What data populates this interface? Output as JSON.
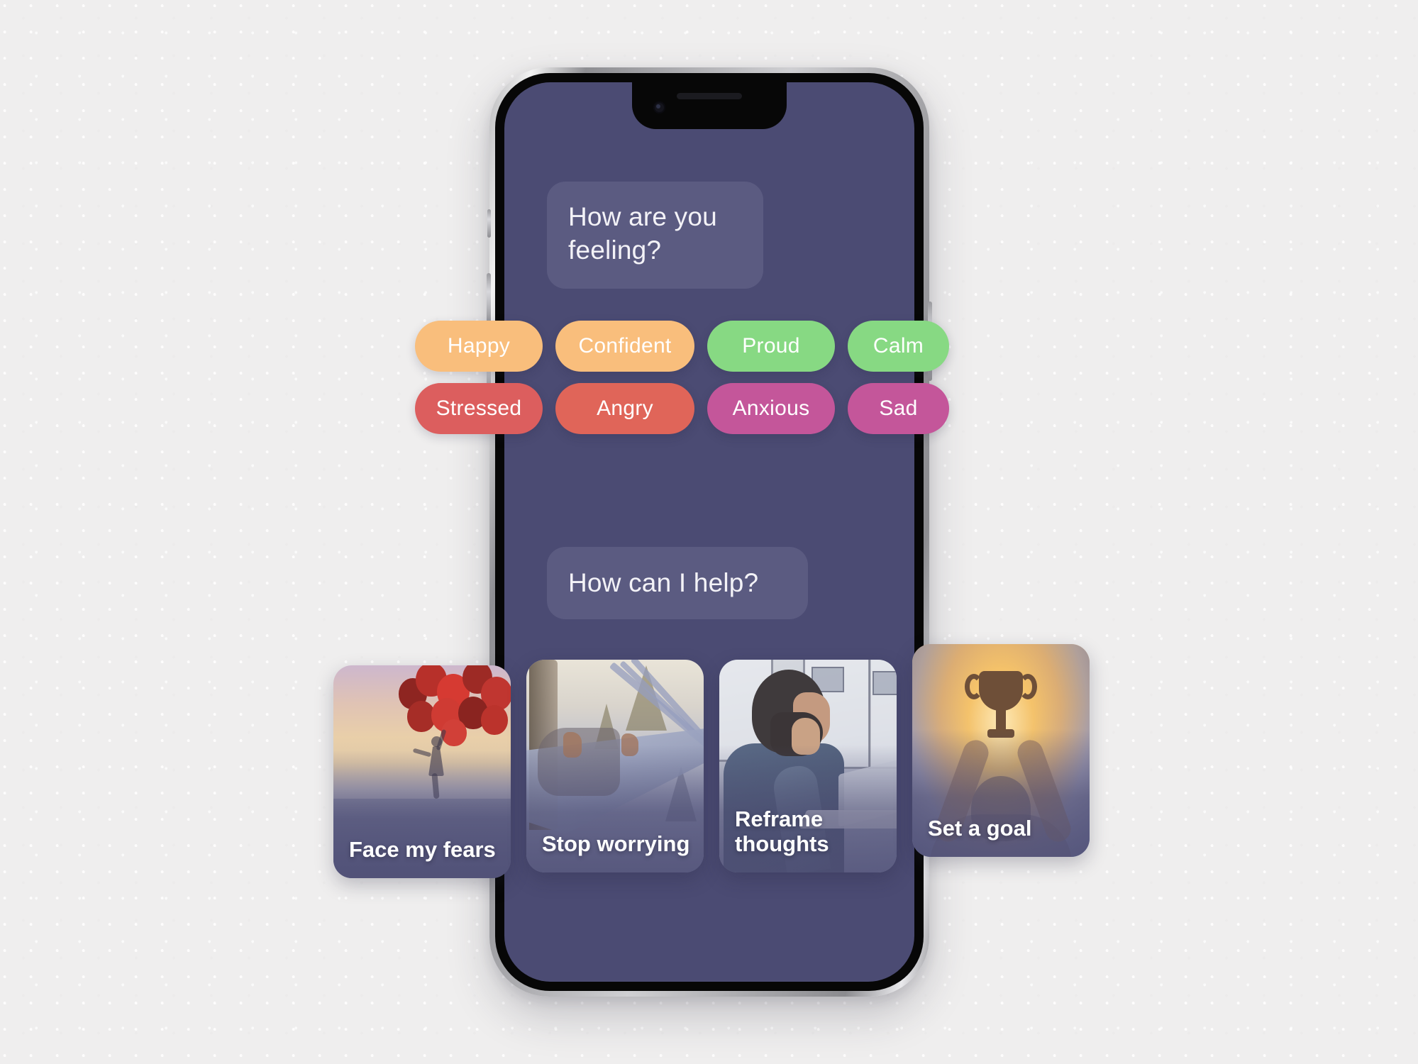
{
  "app": {
    "screen_background": "#4b4b73",
    "bubble_background": "#5b5b81",
    "page_background": "#efeeee"
  },
  "device": {
    "name": "smartphone-mockup",
    "notch": "notch-speaker-camera"
  },
  "chat": {
    "prompt_feeling": "How are you feeling?",
    "prompt_help": "How can I help?"
  },
  "emotions": {
    "row1": [
      {
        "label": "Happy",
        "color": "#f9be7c",
        "key": "happy"
      },
      {
        "label": "Confident",
        "color": "#f9be7c",
        "key": "confident"
      },
      {
        "label": "Proud",
        "color": "#87d983",
        "key": "proud"
      },
      {
        "label": "Calm",
        "color": "#87d983",
        "key": "calm"
      }
    ],
    "row2": [
      {
        "label": "Stressed",
        "color": "#dc5e5e",
        "key": "stressed"
      },
      {
        "label": "Angry",
        "color": "#e06559",
        "key": "angry"
      },
      {
        "label": "Anxious",
        "color": "#c4569a",
        "key": "anxious"
      },
      {
        "label": "Sad",
        "color": "#c4569a",
        "key": "sad"
      }
    ]
  },
  "action_cards": [
    {
      "label": "Face my fears",
      "art": "woman-with-red-balloons-at-dusk"
    },
    {
      "label": "Stop worrying",
      "art": "person-resting-in-hammock-in-forest"
    },
    {
      "label": "Reframe thoughts",
      "art": "man-thinking-at-laptop"
    },
    {
      "label": "Set a goal",
      "art": "hands-raising-trophy-at-sunset"
    }
  ]
}
